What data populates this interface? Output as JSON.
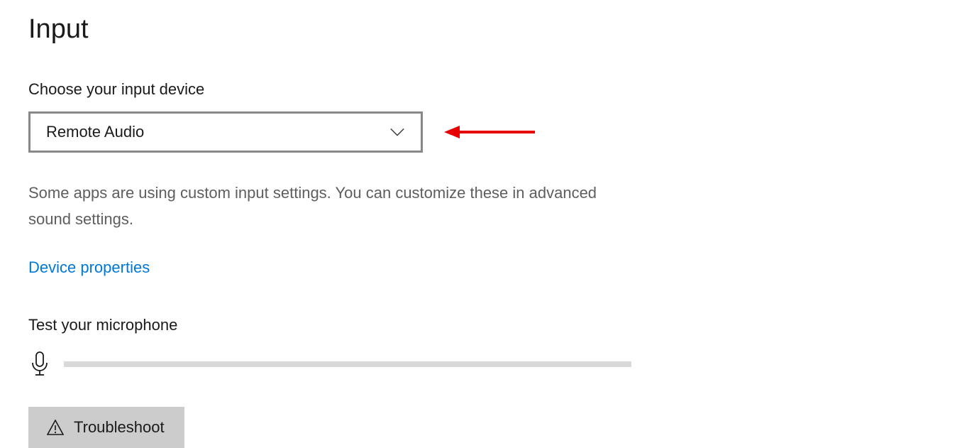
{
  "section": {
    "title": "Input"
  },
  "input_device": {
    "label": "Choose your input device",
    "selected": "Remote Audio"
  },
  "description": "Some apps are using custom input settings. You can customize these in advanced sound settings.",
  "links": {
    "device_properties": "Device properties"
  },
  "mic_test": {
    "label": "Test your microphone"
  },
  "buttons": {
    "troubleshoot": "Troubleshoot"
  }
}
